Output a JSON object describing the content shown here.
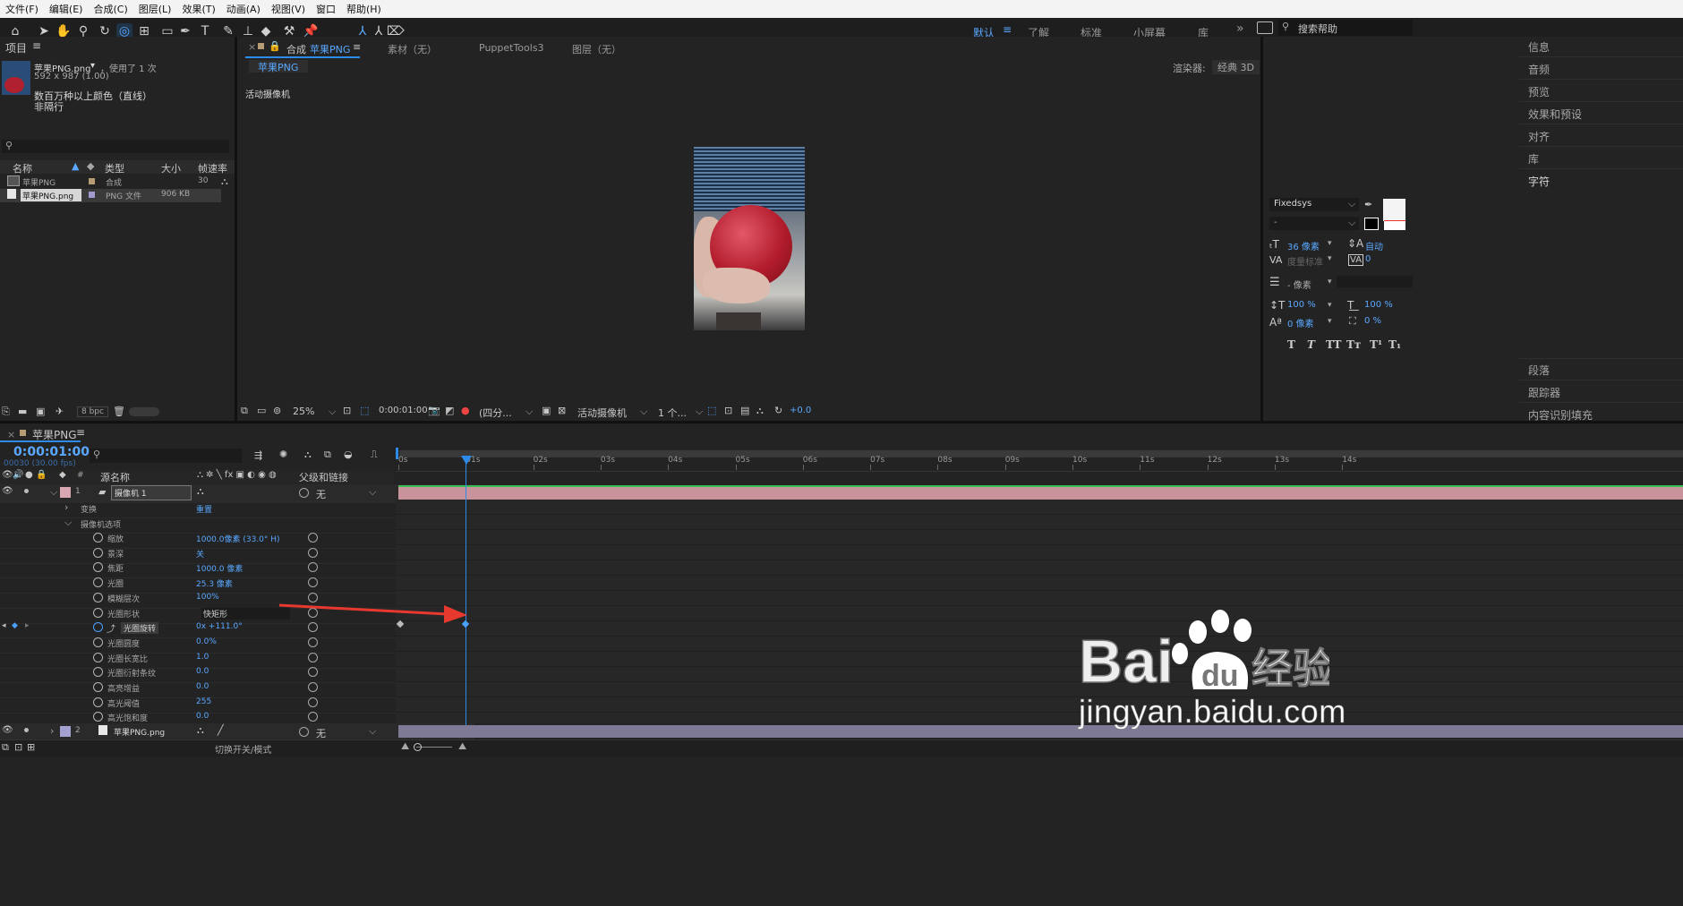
{
  "menu": [
    "文件(F)",
    "编辑(E)",
    "合成(C)",
    "图层(L)",
    "效果(T)",
    "动画(A)",
    "视图(V)",
    "窗口",
    "帮助(H)"
  ],
  "workspaces": {
    "active": "默认",
    "items": [
      "了解",
      "标准",
      "小屏幕",
      "库"
    ],
    "search": "搜索帮助"
  },
  "project": {
    "title": "项目",
    "file_name": "苹果PNG.png",
    "usage": "，使用了 1 次",
    "dims": "592 x 987 (1.00)",
    "color_info": "数百万种以上颜色（直线）",
    "interlace": "非隔行",
    "columns": [
      "名称",
      "类型",
      "大小",
      "帧速率"
    ],
    "items": [
      {
        "name": "苹果PNG",
        "type": "合成",
        "size": "",
        "fps": "30"
      },
      {
        "name": "苹果PNG.png",
        "type": "PNG 文件",
        "size": "906 KB",
        "fps": ""
      }
    ],
    "bpc": "8 bpc"
  },
  "comp": {
    "tabs": {
      "comp_prefix": "合成",
      "comp_name": "苹果PNG",
      "footage": "素材（无）",
      "puppet": "PuppetTools3",
      "layer": "图层（无）"
    },
    "subtab": "苹果PNG",
    "renderer_label": "渲染器:",
    "renderer_value": "经典 3D",
    "camera_label": "活动摄像机",
    "zoom": "25%",
    "timecode": "0:00:01:00",
    "resolution": "(四分...",
    "view": "活动摄像机",
    "views_count": "1 个...",
    "exposure": "+0.0"
  },
  "timeline": {
    "tab": "苹果PNG",
    "time": "0:00:01:00",
    "frame_info": "00030 (30.00 fps)",
    "col_source": "源名称",
    "col_parent": "父级和链接",
    "ruler": [
      "0s",
      "01s",
      "02s",
      "03s",
      "04s",
      "05s",
      "06s",
      "07s",
      "08s",
      "09s",
      "10s",
      "11s",
      "12s",
      "13s",
      "14s"
    ],
    "layer1": {
      "index": "1",
      "name": "摄像机 1",
      "parent": "无"
    },
    "transform": {
      "label": "变换",
      "value": "重置"
    },
    "camera_options": "摄像机选项",
    "props": [
      {
        "name": "缩放",
        "value": "1000.0像素 (33.0° H)"
      },
      {
        "name": "景深",
        "value": "关"
      },
      {
        "name": "焦距",
        "value": "1000.0 像素"
      },
      {
        "name": "光圈",
        "value": "25.3 像素"
      },
      {
        "name": "模糊层次",
        "value": "100%"
      },
      {
        "name": "光圈形状",
        "value": "快矩形"
      },
      {
        "name": "光圈旋转",
        "value": "0x +111.0°"
      },
      {
        "name": "光圈圆度",
        "value": "0.0%"
      },
      {
        "name": "光圈长宽比",
        "value": "1.0"
      },
      {
        "name": "光圈衍射条纹",
        "value": "0.0"
      },
      {
        "name": "高亮增益",
        "value": "0.0"
      },
      {
        "name": "高光阈值",
        "value": "255"
      },
      {
        "name": "高光饱和度",
        "value": "0.0"
      }
    ],
    "layer2": {
      "index": "2",
      "name": "苹果PNG.png",
      "parent": "无"
    },
    "toggle_modes": "切换开关/模式"
  },
  "right": {
    "items": [
      "信息",
      "音频",
      "预览",
      "效果和预设",
      "对齐",
      "库",
      "字符"
    ],
    "font": "Fixedsys",
    "font_style": "-",
    "size": "36 像素",
    "leading": "自动",
    "kerning": "度量标准",
    "tracking": "0",
    "stroke": "- 像素",
    "vscale": "100 %",
    "hscale": "100 %",
    "baseline": "0 像素",
    "tsume": "0 %",
    "type_styles": [
      "T",
      "T",
      "TT",
      "Tт",
      "T¹",
      "T₁"
    ],
    "bottom": [
      "段落",
      "跟踪器",
      "内容识别填充"
    ]
  },
  "watermark": {
    "logo": "Bai du 经验",
    "url": "jingyan.baidu.com"
  },
  "colors": {
    "accent": "#2d8ceb",
    "layer1_bar": "#c9939c",
    "layer2_bar": "#7e7a95",
    "arrow": "#e8392f"
  }
}
